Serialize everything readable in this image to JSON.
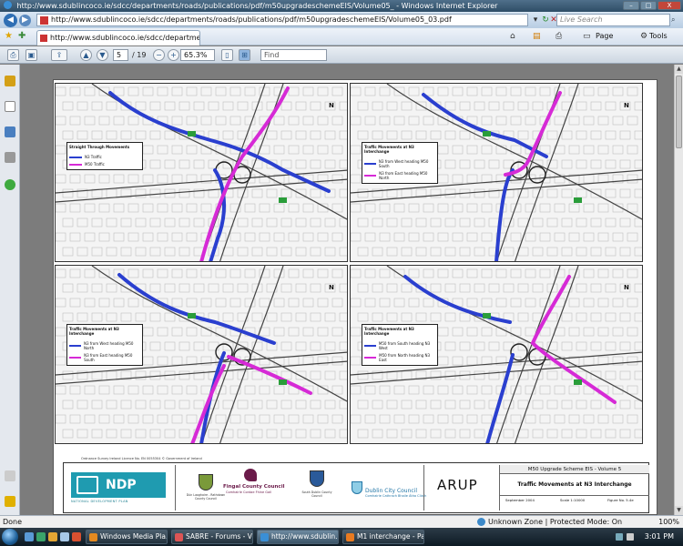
{
  "window": {
    "title": "http://www.sdublincoco.ie/sdcc/departments/roads/publications/pdf/m50upgradeschemeEIS/Volume05_ - Windows Internet Explorer",
    "min_label": "–",
    "max_label": "□",
    "close_label": "X"
  },
  "address": {
    "url": "http://www.sdublincoco.ie/sdcc/departments/roads/publications/pdf/m50upgradeschemeEIS/Volume05_03.pdf",
    "search_placeholder": "Live Search"
  },
  "tab": {
    "label": "http://www.sdublincoco.ie/sdcc/departments/ro..."
  },
  "commands": {
    "page_label": "Page",
    "tools_label": "Tools"
  },
  "pdf_toolbar": {
    "current_page": "5",
    "total_pages": "/ 19",
    "zoom": "65.3%",
    "find_placeholder": "Find"
  },
  "maps": [
    {
      "legend_title": "Straight Through Movements",
      "items": [
        {
          "label": "N3 Traffic",
          "color": "#2a3fcf"
        },
        {
          "label": "M50 Traffic",
          "color": "#d62ad6"
        }
      ]
    },
    {
      "legend_title": "Traffic Movements at N3 Interchange",
      "items": [
        {
          "label": "N3 from West heading M50 South",
          "color": "#2a3fcf"
        },
        {
          "label": "N3 from East heading M50 North",
          "color": "#d62ad6"
        }
      ]
    },
    {
      "legend_title": "Traffic Movements at N3 Interchange",
      "items": [
        {
          "label": "N3 from West heading M50 North",
          "color": "#2a3fcf"
        },
        {
          "label": "N3 from East heading M50 South",
          "color": "#d62ad6"
        }
      ]
    },
    {
      "legend_title": "Traffic Movements at N3 Interchange",
      "items": [
        {
          "label": "M50 from South heading N3 West",
          "color": "#2a3fcf"
        },
        {
          "label": "M50 from North heading N3 East",
          "color": "#d62ad6"
        }
      ]
    }
  ],
  "north_label": "N",
  "copyright": "Ordnance Survey Ireland Licence No. EN 0055304 © Government of Ireland",
  "title_block": {
    "ndp_name": "NDP",
    "ndp_sub": "NATIONAL DEVELOPMENT PLAN",
    "council1": "Dún Laoghaire - Rathdown County Council",
    "council2_name": "Fingal County Council",
    "council2_sub": "Comhairle Contae Fhine Gall",
    "council3": "South Dublin County Council",
    "council4_name": "Dublin City Council",
    "council4_sub": "Comhairle Cathrach Bhaile Átha Cliath",
    "consultant": "ARUP",
    "scheme_title": "M50 Upgrade Scheme EIS - Volume 5",
    "drawing_title": "Traffic Movements at N3 Interchange",
    "date": "September 2004",
    "scale": "Scale 1:10000",
    "figure": "Figure No. 5.4e"
  },
  "status": {
    "left": "Done",
    "zone": "Unknown Zone | Protected Mode: On",
    "zoom": "100%"
  },
  "taskbar": {
    "tasks": [
      "Windows Media Pla...",
      "SABRE - Forums - Vi...",
      "http://www.sdublin...",
      "M1 interchange - Pa..."
    ],
    "clock": "3:01 PM"
  }
}
